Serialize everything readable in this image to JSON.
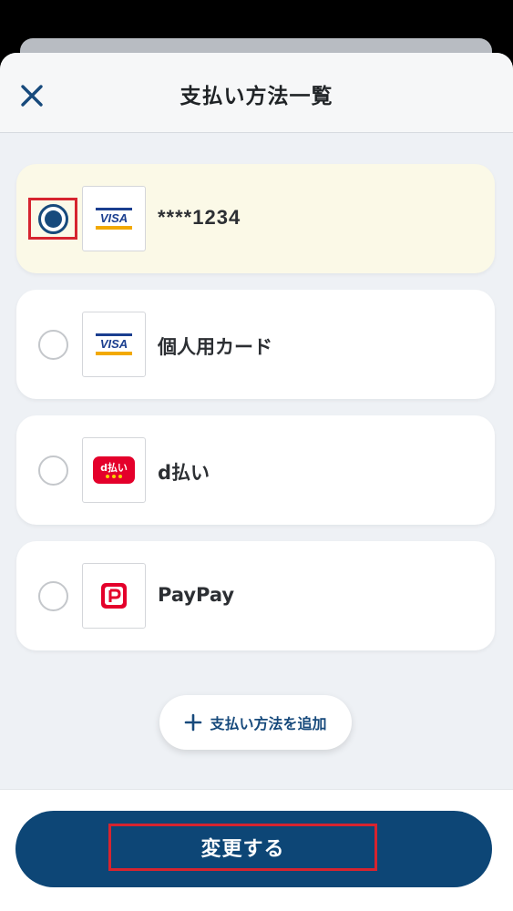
{
  "header": {
    "title": "支払い方法一覧",
    "close_icon": "close-x-icon"
  },
  "payment_methods": [
    {
      "label": "****1234",
      "logo": "visa-logo",
      "selected": true
    },
    {
      "label": "個人用カード",
      "logo": "visa-logo",
      "selected": false
    },
    {
      "label": "d払い",
      "logo": "d-barai-logo",
      "logo_text": "d払い",
      "selected": false
    },
    {
      "label": "PayPay",
      "logo": "paypay-logo",
      "selected": false
    }
  ],
  "visa_logo_text": "VISA",
  "add_button": {
    "label": "支払い方法を追加",
    "icon": "plus-icon"
  },
  "submit_button": {
    "label": "変更する"
  },
  "colors": {
    "primary": "#0d4676",
    "selected_bg": "#fbf9e7",
    "highlight": "#d6242f",
    "paypay_red": "#e4002b"
  }
}
